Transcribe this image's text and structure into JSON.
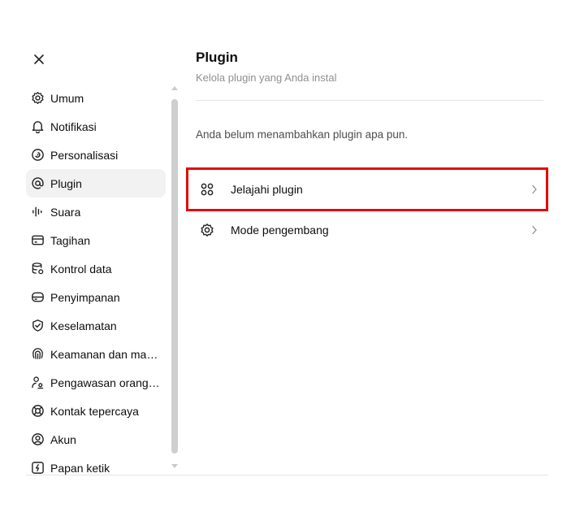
{
  "sidebar": {
    "items": [
      {
        "label": "Umum",
        "icon": "gear-icon"
      },
      {
        "label": "Notifikasi",
        "icon": "bell-icon"
      },
      {
        "label": "Personalisasi",
        "icon": "personalize-icon"
      },
      {
        "label": "Plugin",
        "icon": "at-icon",
        "active": true
      },
      {
        "label": "Suara",
        "icon": "waveform-icon"
      },
      {
        "label": "Tagihan",
        "icon": "credit-card-icon"
      },
      {
        "label": "Kontrol data",
        "icon": "database-gear-icon"
      },
      {
        "label": "Penyimpanan",
        "icon": "storage-icon"
      },
      {
        "label": "Keselamatan",
        "icon": "shield-check-icon"
      },
      {
        "label": "Keamanan dan mas...",
        "icon": "fingerprint-icon"
      },
      {
        "label": "Pengawasan orang ...",
        "icon": "parental-icon"
      },
      {
        "label": "Kontak tepercaya",
        "icon": "lifebuoy-icon"
      },
      {
        "label": "Akun",
        "icon": "account-icon"
      },
      {
        "label": "Papan ketik",
        "icon": "keyboard-icon"
      }
    ]
  },
  "main": {
    "title": "Plugin",
    "subtitle": "Kelola plugin yang Anda instal",
    "empty_text": "Anda belum menambahkan plugin apa pun.",
    "rows": [
      {
        "label": "Jelajahi plugin",
        "icon": "grid-icon"
      },
      {
        "label": "Mode pengembang",
        "icon": "gear-icon"
      }
    ]
  },
  "colors": {
    "highlight": "#e20a0a",
    "active_bg": "#f2f2f2",
    "subtitle": "#8f8f8f"
  }
}
